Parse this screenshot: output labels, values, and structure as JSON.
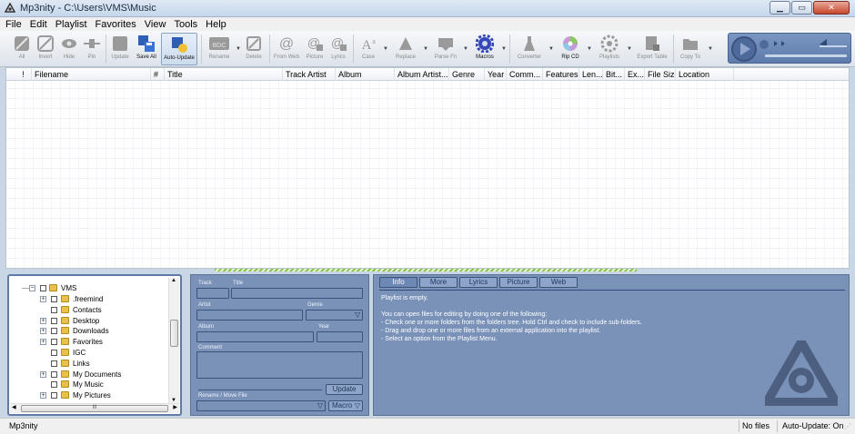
{
  "window": {
    "title": "Mp3nity - C:\\Users\\VMS\\Music"
  },
  "menu": [
    "File",
    "Edit",
    "Playlist",
    "Favorites",
    "View",
    "Tools",
    "Help"
  ],
  "toolbar": {
    "all": "All",
    "invert": "Invert",
    "hide": "Hide",
    "pin": "Pin",
    "update": "Update",
    "save_all": "Save All",
    "auto_update": "Auto-Update",
    "rename": "Rename",
    "delete": "Delete",
    "from_web": "From Web",
    "picture": "Picture",
    "lyrics": "Lyrics",
    "case": "Case",
    "replace": "Replace",
    "parse_fn": "Parse Fn",
    "macros": "Macros",
    "converter": "Converter",
    "rip_cd": "Rip CD",
    "playlists": "Playlists",
    "export_table": "Export Table",
    "copy_to": "Copy To",
    "rename_badge": "BDC"
  },
  "columns": [
    {
      "label": "!"
    },
    {
      "label": "Filename"
    },
    {
      "label": "#"
    },
    {
      "label": "Title"
    },
    {
      "label": "Track Artist"
    },
    {
      "label": "Album"
    },
    {
      "label": "Album Artist..."
    },
    {
      "label": "Genre"
    },
    {
      "label": "Year"
    },
    {
      "label": "Comm..."
    },
    {
      "label": "Features"
    },
    {
      "label": "Len..."
    },
    {
      "label": "Bit..."
    },
    {
      "label": "Ex..."
    },
    {
      "label": "File Size"
    },
    {
      "label": "Location"
    }
  ],
  "tree": {
    "root": "VMS",
    "items": [
      {
        "label": ".freemind",
        "has_children": true
      },
      {
        "label": "Contacts",
        "has_children": false
      },
      {
        "label": "Desktop",
        "has_children": true
      },
      {
        "label": "Downloads",
        "has_children": true
      },
      {
        "label": "Favorites",
        "has_children": true
      },
      {
        "label": "IGC",
        "has_children": false
      },
      {
        "label": "Links",
        "has_children": false
      },
      {
        "label": "My Documents",
        "has_children": true
      },
      {
        "label": "My Music",
        "has_children": false
      },
      {
        "label": "My Pictures",
        "has_children": true
      }
    ],
    "scroll_h_label": "III"
  },
  "tag_editor": {
    "track": "Track",
    "title": "Title",
    "artist": "Artist",
    "genre": "Genre",
    "album": "Album",
    "year": "Year",
    "comment": "Comment",
    "update": "Update",
    "rename_move": "Rename / Move File",
    "macro": "Macro"
  },
  "info": {
    "tabs": [
      "Info",
      "More",
      "Lyrics",
      "Picture",
      "Web"
    ],
    "active_tab": "Info",
    "heading": "Playlist is empty.",
    "lines": [
      "You can open files for editing by doing one of the following:",
      "- Check one or more folders from the folders tree. Hold Ctrl and check to include sub-folders.",
      "- Drag and drop one or more files from an external application into the playlist.",
      "- Select an option from the Playlist Menu."
    ]
  },
  "status": {
    "app": "Mp3nity",
    "files": "No files",
    "auto_update": "Auto-Update: On"
  },
  "colors": {
    "panel": "#7a92b8",
    "accent": "#5f7aa6",
    "hatch": "#89c14a"
  }
}
